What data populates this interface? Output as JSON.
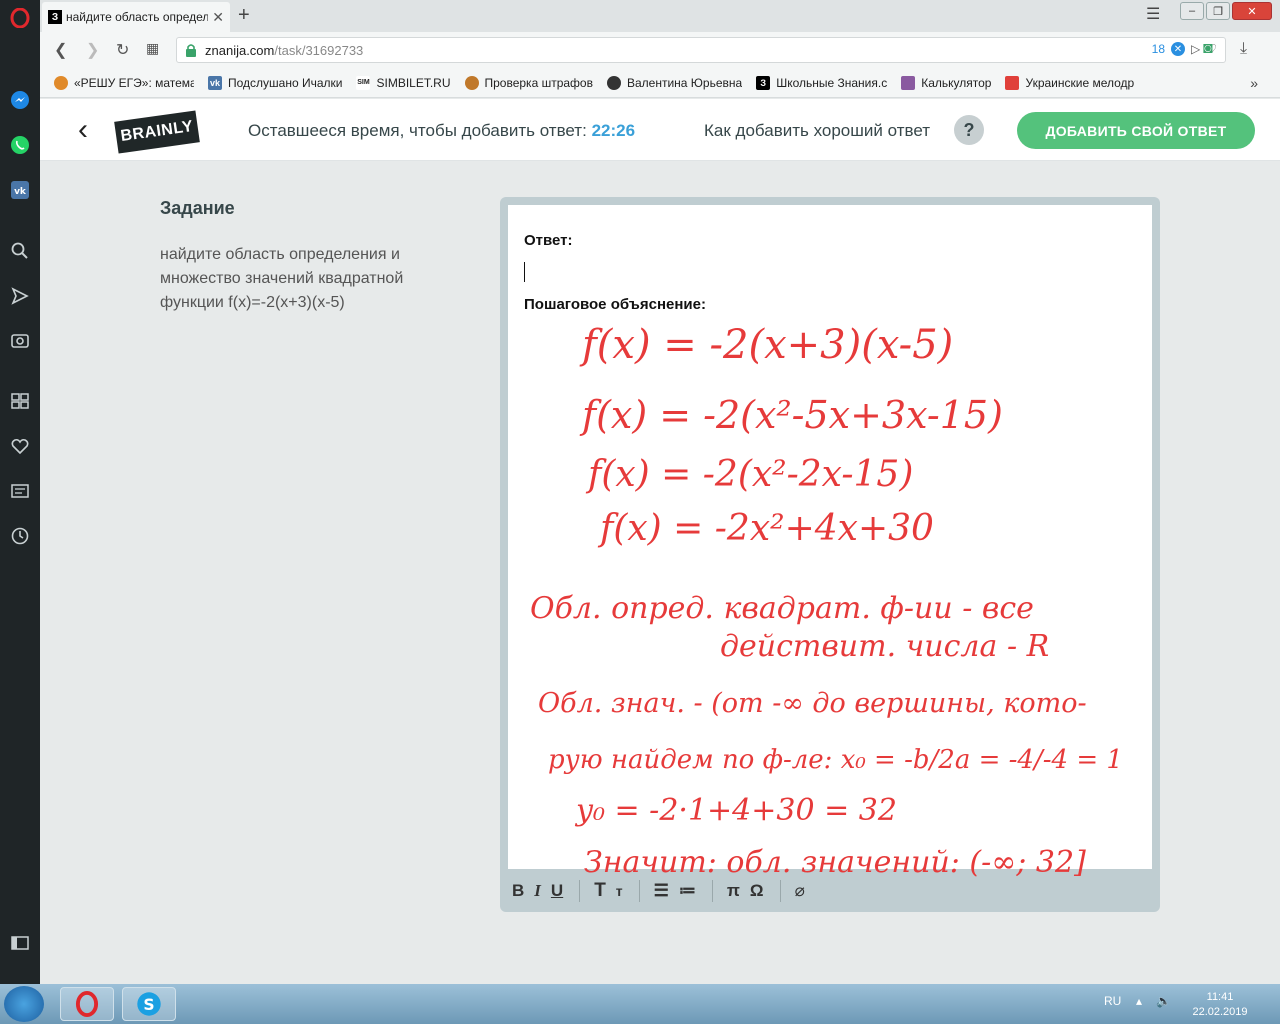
{
  "browser": {
    "tab_title": "найдите область определ",
    "tab_favicon": "З",
    "url_domain": "znanija.com",
    "url_path": "/task/31692733",
    "adblock_count": "18",
    "bookmarks": [
      {
        "label": "«РЕШУ ЕГЭ»: матема",
        "color": "#e08a2a",
        "glyph": ""
      },
      {
        "label": "Подслушано Ичалки",
        "color": "#4a76a8",
        "glyph": "vk"
      },
      {
        "label": "SIMBILET.RU",
        "color": "#ffffff",
        "glyph": "SIM"
      },
      {
        "label": "Проверка штрафов",
        "color": "#c0782a",
        "glyph": ""
      },
      {
        "label": "Валентина Юрьевна",
        "color": "#333333",
        "glyph": ""
      },
      {
        "label": "Школьные Знания.с",
        "color": "#000000",
        "glyph": "З"
      },
      {
        "label": "Калькулятор",
        "color": "#8a5aa0",
        "glyph": ""
      },
      {
        "label": "Украинские мелодр",
        "color": "#e0403a",
        "glyph": ""
      }
    ]
  },
  "header": {
    "time_label": "Оставшееся время, чтобы добавить ответ:",
    "time_value": "22:26",
    "howto_label": "Как добавить хороший ответ",
    "help_glyph": "?",
    "add_answer_label": "ДОБАВИТЬ СВОЙ ОТВЕТ",
    "logo_text": "BRAINLY",
    "accent_green": "#54c27c",
    "accent_blue": "#3aa0d8"
  },
  "task": {
    "title": "Задание",
    "body": "найдите область определения и множество значений квадратной функции f(x)=-2(x+3)(x-5)"
  },
  "editor": {
    "answer_label": "Ответ:",
    "explanation_label": "Пошаговое объяснение:",
    "toolbar": [
      "B",
      "I",
      "U",
      "T",
      "т",
      "list-ordered",
      "list-bullet",
      "π",
      "Ω",
      "attach"
    ]
  },
  "handwriting": {
    "color": "#e63a3a",
    "lines": [
      "f(x) = -2(x+3)(x-5)",
      "f(x) = -2(x²-5x+3x-15)",
      "f(x) = -2(x²-2x-15)",
      "f(x) = -2x²+4x+30",
      "Обл. опред. квадрат. ф-ии - все",
      "действит. числа - R",
      "Обл. знач. - (от -∞ до вершины, кото-",
      "рую найдем по ф-ле: x₀ = -b/2a = -4/-4 = 1",
      "y₀ = -2·1+4+30 = 32",
      "Значит: обл. значений: (-∞; 32]"
    ]
  },
  "taskbar": {
    "lang": "RU",
    "time": "11:41",
    "date": "22.02.2019"
  }
}
